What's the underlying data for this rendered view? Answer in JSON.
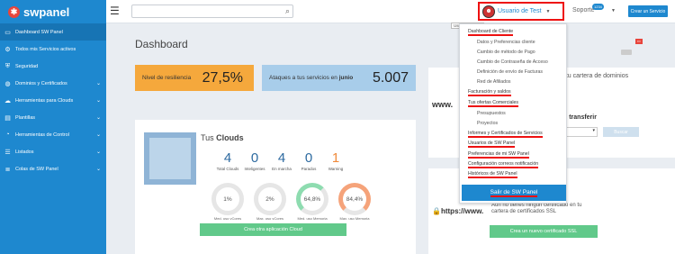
{
  "brand": {
    "name": "swpanel"
  },
  "sidebar": {
    "items": [
      {
        "label": "Dashboard SW Panel",
        "icon": "monitor-icon",
        "active": true
      },
      {
        "label": "Todos mis Servicios activos",
        "icon": "gear-icon"
      },
      {
        "label": "Seguridad",
        "icon": "shield-icon"
      },
      {
        "label": "Dominios y Certificados",
        "icon": "globe-icon",
        "chevron": true
      },
      {
        "label": "Herramientas para Clouds",
        "icon": "cloud-icon",
        "chevron": true
      },
      {
        "label": "Plantillas",
        "icon": "document-icon",
        "chevron": true
      },
      {
        "label": "Herramientas de Control",
        "icon": "gauge-icon",
        "chevron": true
      },
      {
        "label": "Listados",
        "icon": "list-icon",
        "chevron": true
      },
      {
        "label": "Colas de SW Panel",
        "icon": "queue-icon",
        "chevron": true
      }
    ]
  },
  "topbar": {
    "search_placeholder": "",
    "user_name": "Usuario de Test",
    "user_tooltip": "Usuario de Test",
    "support_label": "Soporte",
    "support_badge": "1234",
    "new_service_button": "Crear un Servicio"
  },
  "dropdown": {
    "items": [
      {
        "label": "Dashboard de Cliente",
        "sub": false,
        "underlined": true
      },
      {
        "label": "Datos y Preferencias cliente",
        "sub": true
      },
      {
        "label": "Cambio de método de Pago",
        "sub": true
      },
      {
        "label": "Cambio de Contraseña de Acceso",
        "sub": true
      },
      {
        "label": "Definición de envío de Facturas",
        "sub": true
      },
      {
        "label": "Red de Afiliados",
        "sub": true
      },
      {
        "label": "Facturación y saldos",
        "sub": false,
        "underlined": true
      },
      {
        "label": "Tus ofertas Comerciales",
        "sub": false,
        "underlined": true
      },
      {
        "label": "Presupuestos",
        "sub": true
      },
      {
        "label": "Proyectos",
        "sub": true
      },
      {
        "label": "Informes y Certificados de Servicios",
        "sub": false,
        "underlined": true
      },
      {
        "label": "Usuarios de SW Panel",
        "sub": false,
        "underlined": true
      },
      {
        "label": "Preferencias de mi SW Panel",
        "sub": false,
        "underlined": true
      },
      {
        "label": "Configuración correos notificación",
        "sub": false,
        "underlined": true
      },
      {
        "label": "Históricos de SW Panel",
        "sub": false,
        "underlined": true
      }
    ],
    "logout_button": "Salir de SW Panel"
  },
  "page": {
    "title": "Dashboard"
  },
  "stats": {
    "resilience_label": "Nivel de resiliencia",
    "resilience_value": "27,5%",
    "attacks_label_prefix": "Ataques a tus servicios en ",
    "attacks_month": "junio",
    "attacks_value": "5.007"
  },
  "clouds": {
    "title_prefix": "Tus ",
    "title_bold": "Clouds",
    "counts": [
      {
        "value": "4",
        "label": "Total Clouds"
      },
      {
        "value": "0",
        "label": "Inteligentes"
      },
      {
        "value": "4",
        "label": "En marcha"
      },
      {
        "value": "0",
        "label": "Parados"
      },
      {
        "value": "1",
        "label": "Warning",
        "warn": true
      }
    ],
    "gauges": [
      {
        "value": "1%",
        "label": "Med. uso vCores",
        "level": "low"
      },
      {
        "value": "2%",
        "label": "Max. uso vCores",
        "level": "low"
      },
      {
        "value": "64,8%",
        "label": "Med. uso Memoria",
        "level": "mid"
      },
      {
        "value": "84,4%",
        "label": "Max. uso Memoria",
        "level": "high"
      }
    ],
    "create_button": "Crea otra aplicación Cloud"
  },
  "domains": {
    "www_label": "www.",
    "text": "n tu cartera de dominios",
    "transfer_label": "o transferir",
    "button": "Buscar"
  },
  "certs": {
    "https_label": "https://www.",
    "text": "Aún no tienes ningún certificado en tu cartera de certificados SSL",
    "button": "Crea un nuevo certificado SSL"
  }
}
